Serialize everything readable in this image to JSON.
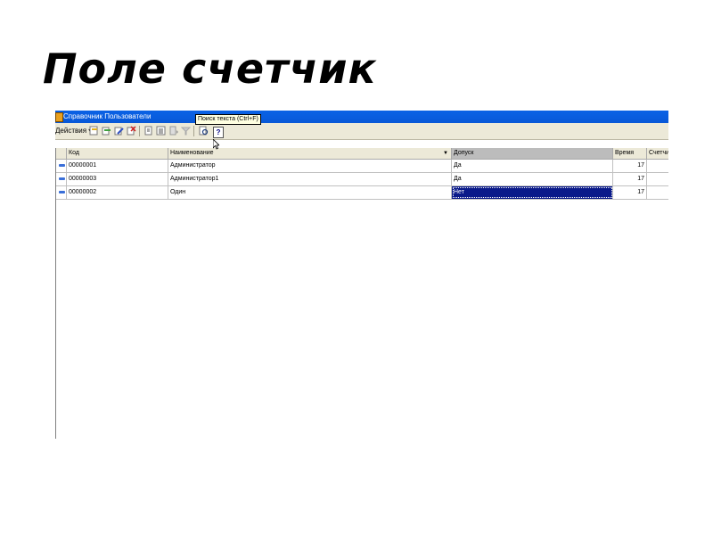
{
  "slide": {
    "title": "Поле счетчик"
  },
  "window": {
    "title": "Справочник Пользователи",
    "tooltip": "Поиск текста (Ctrl+F)",
    "help_label": "?"
  },
  "toolbar": {
    "actions_label": "Действия",
    "buttons": [
      "add-icon",
      "copy-icon",
      "edit-icon",
      "delete-icon",
      "refresh-icon",
      "list-icon",
      "filter-icon",
      "filter-off-icon",
      "search-icon",
      "help-icon"
    ]
  },
  "table": {
    "columns": [
      "Код",
      "Наименование",
      "Допуск",
      "Время",
      "Счетчик"
    ],
    "rows": [
      {
        "code": "00000001",
        "name": "Администратор",
        "access": "Да",
        "time": "17"
      },
      {
        "code": "00000003",
        "name": "Администратор1",
        "access": "Да",
        "time": "17"
      },
      {
        "code": "00000002",
        "name": "Один",
        "access": "Нет",
        "time": "17"
      }
    ]
  },
  "colors": {
    "titlebar": "#0a62e6",
    "selection": "#0a1a8a",
    "toolbar_bg": "#ece9d8"
  }
}
